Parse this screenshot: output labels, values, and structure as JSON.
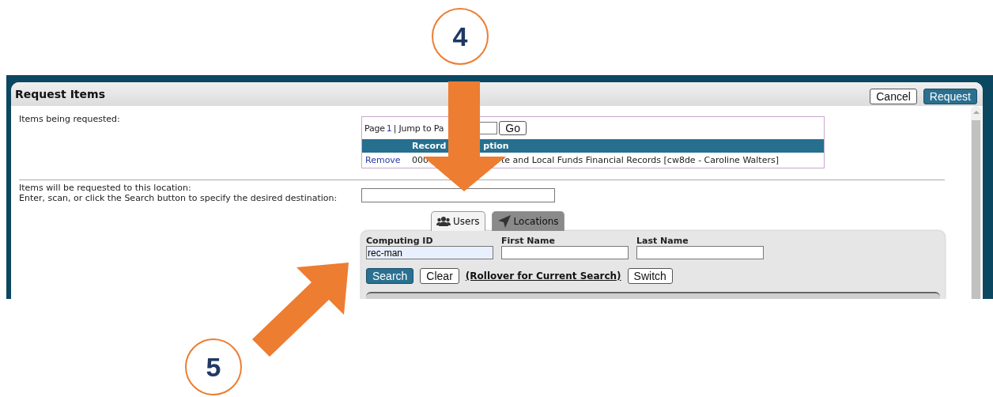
{
  "annotations": [
    {
      "number": "4"
    },
    {
      "number": "5"
    }
  ],
  "dialog": {
    "title": "Request Items",
    "buttons": [
      {
        "label": "Cancel",
        "kind": "secondary"
      },
      {
        "label": "Request",
        "kind": "primary"
      }
    ]
  },
  "items_label": "Items being requested:",
  "pager": {
    "label": "Page",
    "page": "1",
    "jump_label": "| Jump to Pa",
    "go": "Go"
  },
  "table": {
    "header_texts": [
      "Record",
      "ption"
    ],
    "rows": [
      {
        "action": "Remove",
        "texts": [
          "000",
          "te and Local Funds Financial Records [cw8de - Caroline Walters]"
        ]
      }
    ]
  },
  "location_lines": [
    "Items will be requested to this location:",
    "Enter, scan, or click the Search button to specify the desired destination:"
  ],
  "tabs": [
    {
      "label": "Users",
      "selected": true
    },
    {
      "label": "Locations",
      "selected": false
    }
  ],
  "search_fields": [
    {
      "label": "Computing ID",
      "value": "rec-man"
    },
    {
      "label": "First Name"
    },
    {
      "label": "Last Name"
    }
  ],
  "search_buttons": [
    {
      "label": "Search",
      "kind": "primary"
    },
    {
      "label": "Clear",
      "kind": "secondary"
    },
    {
      "label": "(Rollover for Current Search)",
      "kind": "link"
    },
    {
      "label": "Switch",
      "kind": "secondary"
    }
  ]
}
